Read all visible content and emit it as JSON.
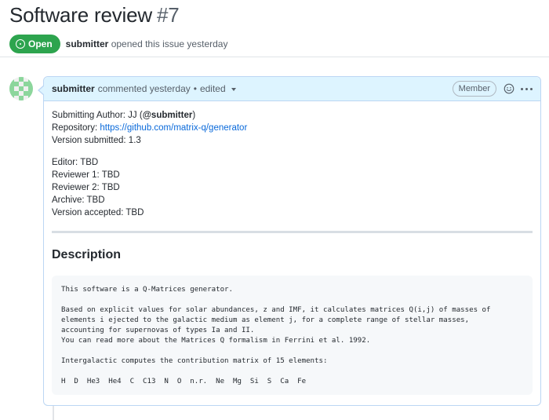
{
  "issue": {
    "title": "Software review",
    "number": "#7",
    "state": "Open",
    "opener": "submitter",
    "opened_text": "opened this issue yesterday"
  },
  "comment": {
    "author": "submitter",
    "action": "commented yesterday",
    "separator": "•",
    "edited": "edited",
    "role_badge": "Member",
    "submitting_author_label": "Submitting Author: JJ (",
    "submitting_author_handle": "@submitter",
    "submitting_author_close": ")",
    "repository_label": "Repository: ",
    "repository_url": "https://github.com/matrix-q/generator",
    "version_submitted": "Version submitted: 1.3",
    "editor": "Editor: TBD",
    "reviewer1": "Reviewer 1: TBD",
    "reviewer2": "Reviewer 2: TBD",
    "archive": "Archive: TBD",
    "version_accepted": "Version accepted: TBD",
    "description_heading": "Description",
    "code_lines": [
      "This software is a Q-Matrices generator.",
      "",
      "Based on explicit values for solar abundances, z and IMF, it calculates matrices Q(i,j) of masses of",
      "elements i ejected to the galactic medium as element j, for a complete range of stellar masses,",
      "accounting for supernovas of types Ia and II.",
      "You can read more about the Matrices Q formalism in Ferrini et al. 1992.",
      "",
      "Intergalactic computes the contribution matrix of 15 elements:",
      "",
      "H  D  He3  He4  C  C13  N  O  n.r.  Ne  Mg  Si  S  Ca  Fe"
    ]
  },
  "icons": {
    "state": "issue-opened-icon",
    "caret": "triangle-down-icon",
    "reaction": "smiley-icon",
    "options": "kebab-horizontal-icon",
    "avatar": "identicon-avatar"
  },
  "colors": {
    "open_green": "#2da44e",
    "link_blue": "#0969da",
    "header_bg": "#ddf4ff",
    "header_border": "#bcd6f3",
    "avatar_green": "#8cd69c"
  }
}
